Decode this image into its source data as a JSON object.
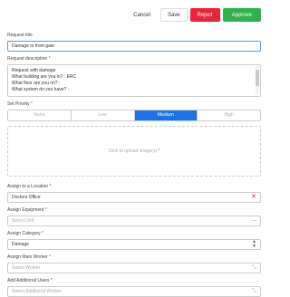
{
  "toolbar": {
    "cancel_label": "Cancel",
    "save_label": "Save",
    "reject_label": "Reject",
    "approve_label": "Approve"
  },
  "form": {
    "title": {
      "label": "Request title",
      "value": "Damage to front gate"
    },
    "description": {
      "label": "Request description",
      "required_mark": "*",
      "lines": [
        "Request with damage",
        "What building are you in? : ERC",
        "What floor are you on? :",
        "What system do you have? :"
      ]
    },
    "priority": {
      "label": "Set Priority",
      "required_mark": "*",
      "options": [
        "None",
        "Low",
        "Medium",
        "High"
      ],
      "selected": "Medium"
    },
    "upload": {
      "text": "Click to upload image(s)",
      "required_mark": "*"
    },
    "location": {
      "label": "Assign to a Location",
      "required_mark": "*",
      "value": "Doctors Office"
    },
    "equipment": {
      "label": "Assign Equipment",
      "required_mark": "*",
      "placeholder": "Select Unit",
      "dots": "..."
    },
    "category": {
      "label": "Assign Category",
      "required_mark": "*",
      "value": "Damage"
    },
    "main_worker": {
      "label": "Assign Main Worker",
      "required_mark": "*",
      "placeholder": "Select Worker"
    },
    "additional_users": {
      "label": "Add Additional Users",
      "required_mark": "*",
      "placeholder": "Select Additional Worker"
    }
  },
  "colors": {
    "reject": "#e8243b",
    "approve": "#2db34a",
    "priority_active": "#1a73e8"
  }
}
